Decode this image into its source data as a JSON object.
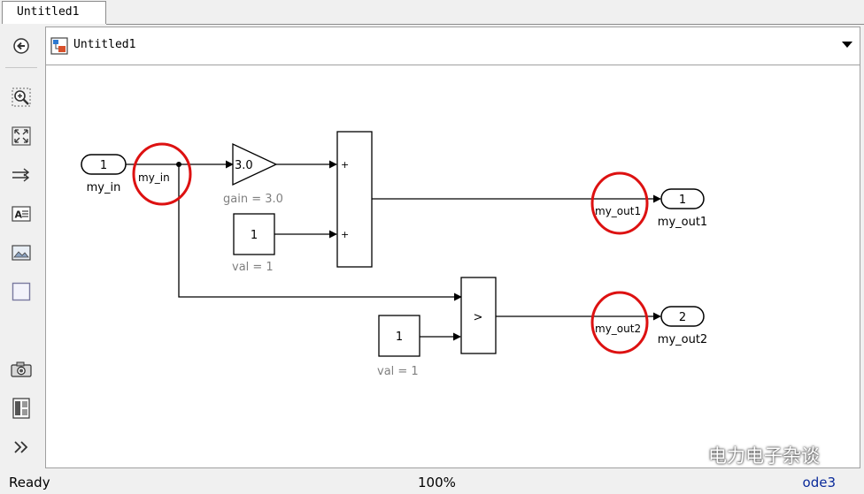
{
  "tab": {
    "label": "Untitled1"
  },
  "address": {
    "model_name": "Untitled1"
  },
  "diagram": {
    "inport": {
      "number": "1",
      "name": "my_in"
    },
    "signal_in": "my_in",
    "gain": {
      "value": "3.0",
      "caption": "gain = 3.0"
    },
    "const1": {
      "value": "1",
      "caption": "val = 1"
    },
    "sum": {
      "sign1": "+",
      "sign2": "+"
    },
    "signal_out1": "my_out1",
    "outport1": {
      "number": "1",
      "name": "my_out1"
    },
    "relop": {
      "op": ">"
    },
    "const2": {
      "value": "1",
      "caption": "val = 1"
    },
    "signal_out2": "my_out2",
    "outport2": {
      "number": "2",
      "name": "my_out2"
    }
  },
  "status": {
    "state": "Ready",
    "zoom": "100%",
    "solver": "ode3"
  },
  "watermark": {
    "text": "电力电子杂谈"
  },
  "colors": {
    "highlight_circle": "#dd1111",
    "line": "#000000",
    "block_border": "#000000",
    "caption": "#808080"
  },
  "toolbar": {
    "icons": [
      "back-icon",
      "zoom-in-icon",
      "fit-view-icon",
      "arrow-routing-icon",
      "annotation-icon",
      "image-icon",
      "area-icon",
      "camera-icon",
      "model-browser-icon",
      "expand-icon"
    ]
  }
}
